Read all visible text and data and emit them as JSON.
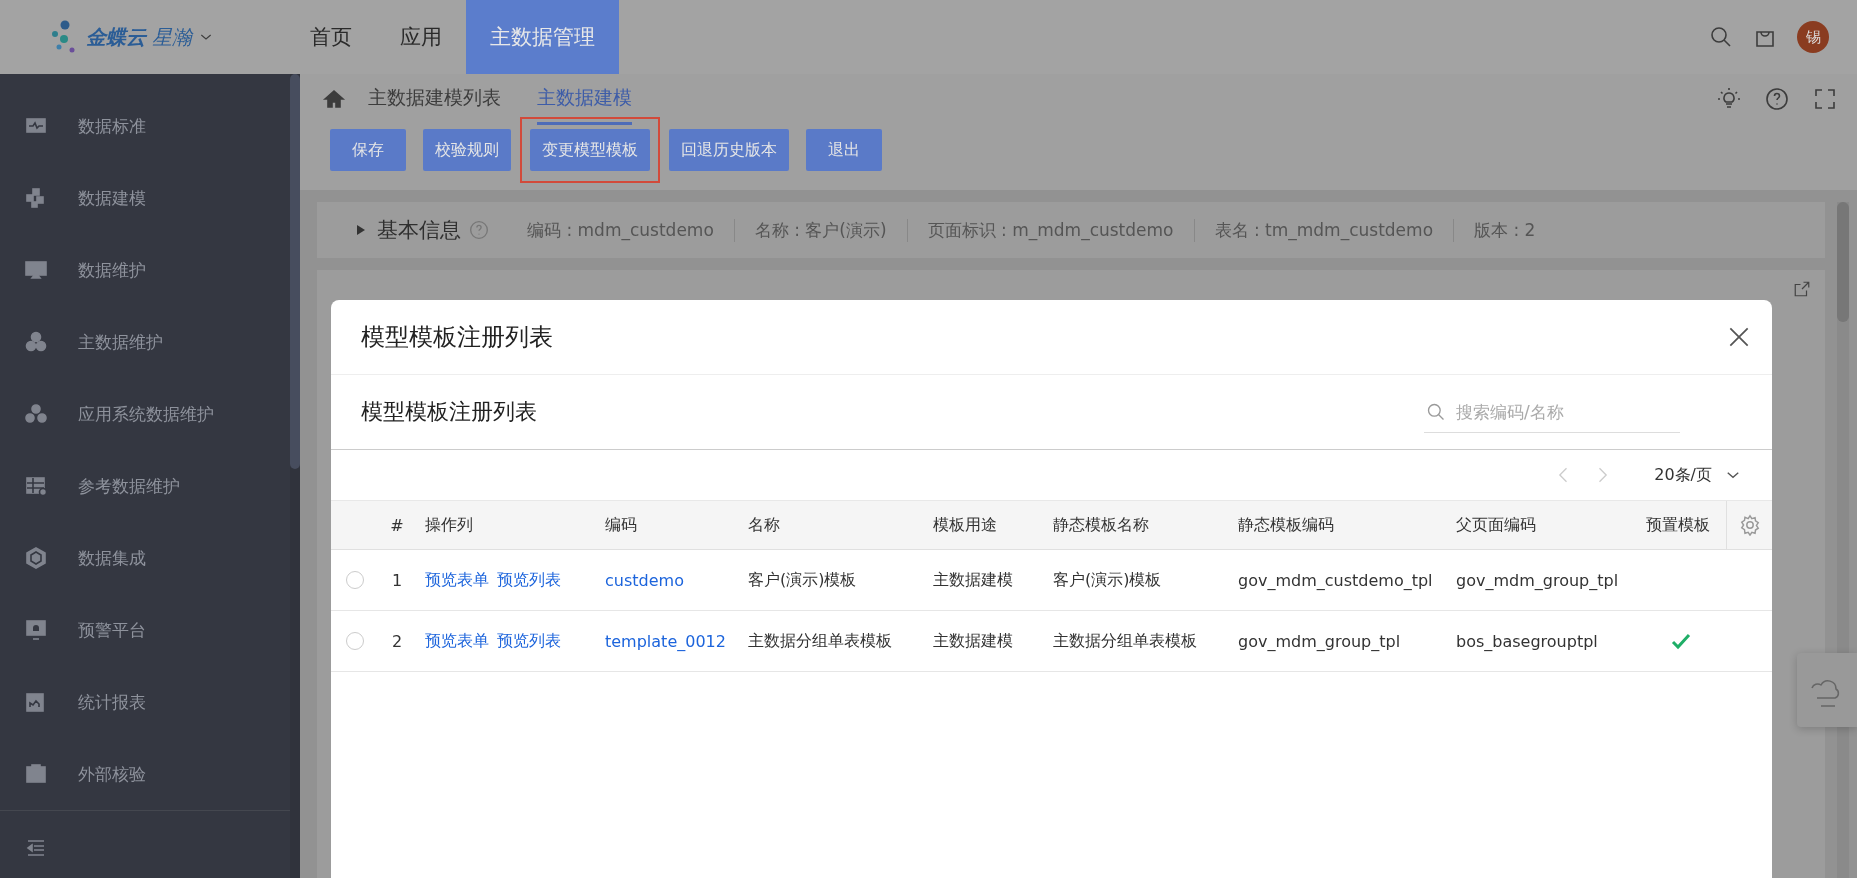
{
  "top_bar": {
    "brand": "金蝶云",
    "product": "星瀚",
    "nav": [
      {
        "label": "首页",
        "selected": false
      },
      {
        "label": "应用",
        "selected": false
      },
      {
        "label": "主数据管理",
        "selected": true
      }
    ],
    "avatar": "锡"
  },
  "sidebar": {
    "items": [
      "数据标准",
      "数据建模",
      "数据维护",
      "主数据维护",
      "应用系统数据维护",
      "参考数据维护",
      "数据集成",
      "预警平台",
      "统计报表",
      "外部核验"
    ]
  },
  "tabs": [
    {
      "label": "主数据建模列表",
      "selected": false
    },
    {
      "label": "主数据建模",
      "selected": true
    }
  ],
  "toolbar": [
    {
      "label": "保存",
      "highlighted": false
    },
    {
      "label": "校验规则",
      "highlighted": false
    },
    {
      "label": "变更模型模板",
      "highlighted": true
    },
    {
      "label": "回退历史版本",
      "highlighted": false
    },
    {
      "label": "退出",
      "highlighted": false
    }
  ],
  "basic_info": {
    "title": "基本信息",
    "expanded": false,
    "fields": [
      "编码 : mdm_custdemo",
      "名称 : 客户(演示)",
      "页面标识 : m_mdm_custdemo",
      "表名 : tm_mdm_custdemo",
      "版本 : 2"
    ]
  },
  "dialog": {
    "title": "模型模板注册列表",
    "list_title": "模型模板注册列表",
    "search": {
      "placeholder": "搜索编码/名称"
    },
    "page_size": "20条/页",
    "columns": [
      "#",
      "操作列",
      "编码",
      "名称",
      "模板用途",
      "静态模板名称",
      "静态模板编码",
      "父页面编码",
      "预置模板"
    ],
    "rows": [
      {
        "selected": false,
        "index": "1",
        "actions": [
          "预览表单",
          "预览列表"
        ],
        "code": "custdemo",
        "name": "客户(演示)模板",
        "usage": "主数据建模",
        "static_name": "客户(演示)模板",
        "static_code": "gov_mdm_custdemo_tpl",
        "parent_code": "gov_mdm_group_tpl",
        "preset": false
      },
      {
        "selected": false,
        "index": "2",
        "actions": [
          "预览表单",
          "预览列表"
        ],
        "code": "template_0012",
        "name": "主数据分组单表模板",
        "usage": "主数据建模",
        "static_name": "主数据分组单表模板",
        "static_code": "gov_mdm_group_tpl",
        "parent_code": "bos_basegrouptpl",
        "preset": true
      }
    ]
  }
}
